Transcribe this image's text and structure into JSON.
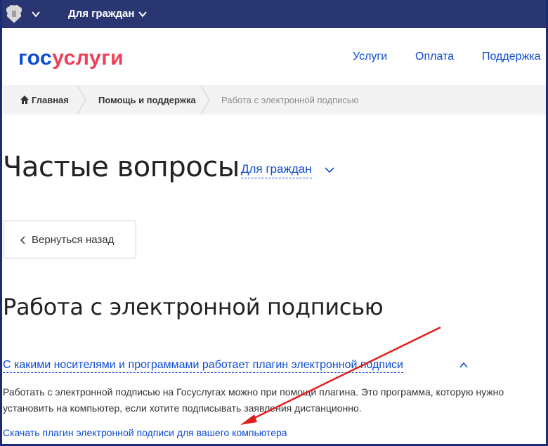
{
  "topbar": {
    "audience_label": "Для граждан"
  },
  "header": {
    "logo_part1": "гос",
    "logo_part2": "услуги",
    "nav": [
      "Услуги",
      "Оплата",
      "Поддержка"
    ]
  },
  "breadcrumb": {
    "items": [
      "Главная",
      "Помощь и поддержка",
      "Работа с электронной подписью"
    ]
  },
  "main": {
    "title": "Частые вопросы",
    "audience_selector": "Для граждан",
    "back_button": "Вернуться назад",
    "section_title": "Работа с электронной подписью",
    "question": "С какими носителями и программами работает плагин электронной подписи",
    "answer_line1": "Работать с электронной подписью на Госуслугах можно при помощи плагина. Это программа, которую нужно",
    "answer_line2": "установить на компьютер, если хотите подписывать заявления дистанционно.",
    "download_link": "Скачать плагин электронной подписи для вашего компьютера"
  },
  "colors": {
    "topbar": "#2a3672",
    "link": "#0d4cd3",
    "logo_blue": "#0d4cd3",
    "logo_red": "#ee3f58",
    "annotation_arrow": "#e0201b"
  },
  "icons": [
    "emblem-icon",
    "chevron-down-icon",
    "home-icon",
    "chevron-left-icon",
    "chevron-up-icon"
  ]
}
